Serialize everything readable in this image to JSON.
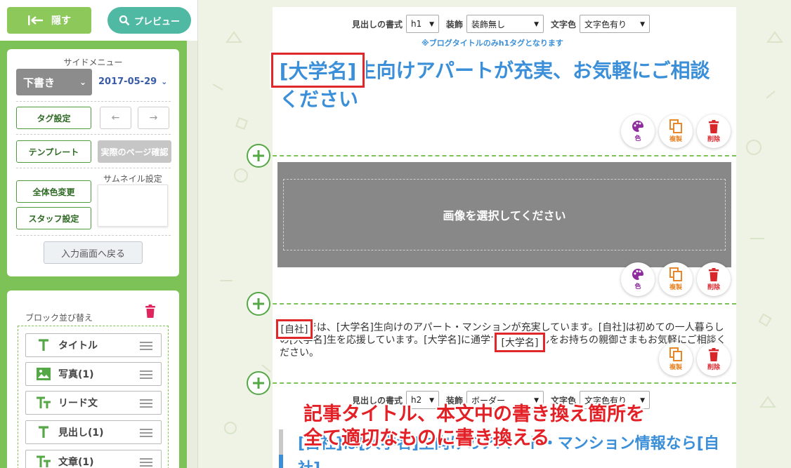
{
  "top": {
    "hide_label": "隠す",
    "preview_label": "プレビュー"
  },
  "side_menu": {
    "title": "サイドメニュー",
    "status_select": "下書き",
    "date": "2017-05-29",
    "tag_settings": "タグ設定",
    "template": "テンプレート",
    "actual_page_check": "実際のページ確認",
    "thumbnail_label": "サムネイル設定",
    "all_color_change": "全体色変更",
    "staff_settings": "スタッフ設定",
    "back_to_input": "入力画面へ戻る"
  },
  "block_sort": {
    "title": "ブロック並び替え",
    "items": [
      {
        "label": "タイトル",
        "icon": "title-t-icon"
      },
      {
        "label": "写真(1)",
        "icon": "image-icon"
      },
      {
        "label": "リード文",
        "icon": "text-tt-icon"
      },
      {
        "label": "見出し(1)",
        "icon": "title-t-icon"
      },
      {
        "label": "文章(1)",
        "icon": "text-tt-icon"
      }
    ]
  },
  "heading_block_1": {
    "format_label": "見出しの書式",
    "format_value": "h1",
    "deco_label": "装飾",
    "deco_value": "装飾無し",
    "color_label": "文字色",
    "color_value": "文字色有り",
    "note": "※ブログタイトルのみh1タグとなります",
    "title_marker": "[大学名]",
    "title_rest": "生向けアパートが充実、お気軽にご相談ください"
  },
  "block_actions": {
    "color": "色",
    "copy": "複製",
    "delete": "削除"
  },
  "image_block": {
    "placeholder": "画像を選択してください"
  },
  "text_block": {
    "marker1": "[自社]",
    "text": "[自社]では、[大学名]生向けのアパート・マンションが充実しています。[自社]は初めての一人暮らしの[大学名]生を応援しています。[大学名]に通学する学生さんをお持ちの親御さまもお気軽にご相談ください。",
    "marker2": "[大学名]"
  },
  "heading_block_2": {
    "format_label": "見出しの書式",
    "format_value": "h2",
    "deco_label": "装飾",
    "deco_value": "ボーダー",
    "color_label": "文字色",
    "color_value": "文字色有り",
    "title": "[自社]は[大学名]生向けのアパート・マンション情報なら[自社]"
  },
  "annotation": {
    "line1": "記事タイトル、本文中の書き換え箇所を",
    "line2": "全て適切なものに書き換える"
  },
  "colors": {
    "green": "#7cc256",
    "teal": "#4fb9a4",
    "blue": "#3a8fd8",
    "red": "#e0282a"
  }
}
